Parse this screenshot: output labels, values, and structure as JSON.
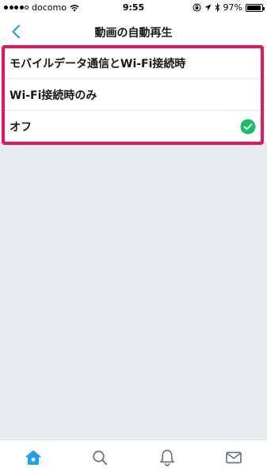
{
  "status_bar": {
    "carrier": "docomo",
    "time": "9:55",
    "battery_percent": "97%",
    "battery_level": 0.97
  },
  "nav": {
    "title": "動画の自動再生",
    "back_icon": "chevron-left-icon"
  },
  "options": [
    {
      "label": "モバイルデータ通信とWi-Fi接続時",
      "selected": false
    },
    {
      "label": "Wi-Fi接続時のみ",
      "selected": false
    },
    {
      "label": "オフ",
      "selected": true
    }
  ],
  "colors": {
    "accent": "#1da1f2",
    "check": "#17bf63",
    "highlight": "#e8175d",
    "background": "#e6ecf0"
  },
  "tabs": [
    {
      "icon": "home-icon",
      "active": true
    },
    {
      "icon": "search-icon",
      "active": false
    },
    {
      "icon": "notifications-icon",
      "active": false
    },
    {
      "icon": "messages-icon",
      "active": false
    }
  ]
}
